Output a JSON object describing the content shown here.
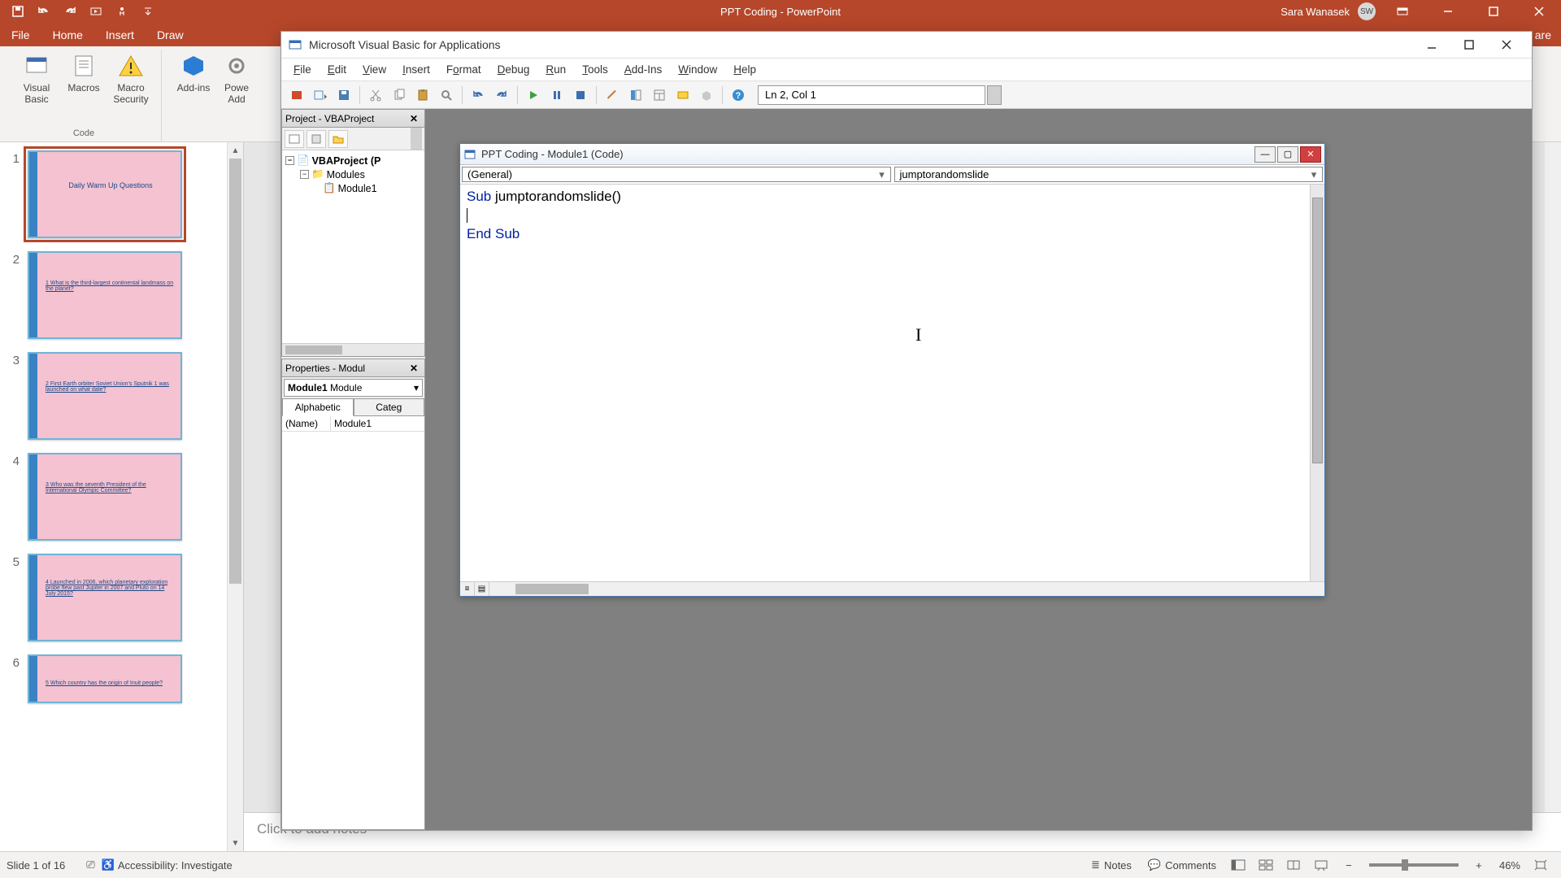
{
  "app": {
    "title": "PPT Coding  -  PowerPoint",
    "user_name": "Sara Wanasek",
    "user_initials": "SW"
  },
  "tabs": [
    "File",
    "Home",
    "Insert",
    "Draw"
  ],
  "ribbon": {
    "group_code_label": "Code",
    "visual_basic": "Visual Basic",
    "macros": "Macros",
    "macro_security": "Macro Security",
    "addins": "Add-ins",
    "powe": "Powe",
    "add": "Add"
  },
  "thumbs": [
    {
      "n": "1",
      "title": "Daily Warm Up Questions",
      "selected": true,
      "body": ""
    },
    {
      "n": "2",
      "title": "",
      "body": "1  What is the third-largest continental landmass on the planet?"
    },
    {
      "n": "3",
      "title": "",
      "body": "2  First Earth orbiter Soviet Union's Sputnik 1 was launched on what date?"
    },
    {
      "n": "4",
      "title": "",
      "body": "3  Who was the seventh President of the International Olympic Committee?"
    },
    {
      "n": "5",
      "title": "",
      "body": "4  Launched in 2006, which planetary exploration probe flew past Jupiter in 2007 and Pluto on 14 July 2015?"
    },
    {
      "n": "6",
      "title": "",
      "body": "5  Which country has the origin of Inuit people?"
    }
  ],
  "notes_placeholder": "Click to add notes",
  "status": {
    "slide": "Slide 1 of 16",
    "accessibility": "Accessibility: Investigate",
    "notes": "Notes",
    "comments": "Comments",
    "zoom": "46%"
  },
  "vba": {
    "title": "Microsoft Visual Basic for Applications",
    "menus": [
      "File",
      "Edit",
      "View",
      "Insert",
      "Format",
      "Debug",
      "Run",
      "Tools",
      "Add-Ins",
      "Window",
      "Help"
    ],
    "cursor_pos": "Ln 2, Col 1",
    "project_panel_title": "Project - VBAProject",
    "project_root": "VBAProject (P",
    "project_modules_folder": "Modules",
    "project_module1": "Module1",
    "properties_panel_title": "Properties - Modul",
    "properties_object": "Module1",
    "properties_object_type": "Module",
    "prop_tab_alpha": "Alphabetic",
    "prop_tab_cat": "Categ",
    "prop_name_key": "(Name)",
    "prop_name_val": "Module1"
  },
  "code_window": {
    "title": "PPT Coding - Module1 (Code)",
    "combo_left": "(General)",
    "combo_right": "jumptorandomslide",
    "line1a": "Sub",
    "line1b": " jumptorandomslide()",
    "line3a": "End",
    "line3b": " ",
    "line3c": "Sub"
  }
}
